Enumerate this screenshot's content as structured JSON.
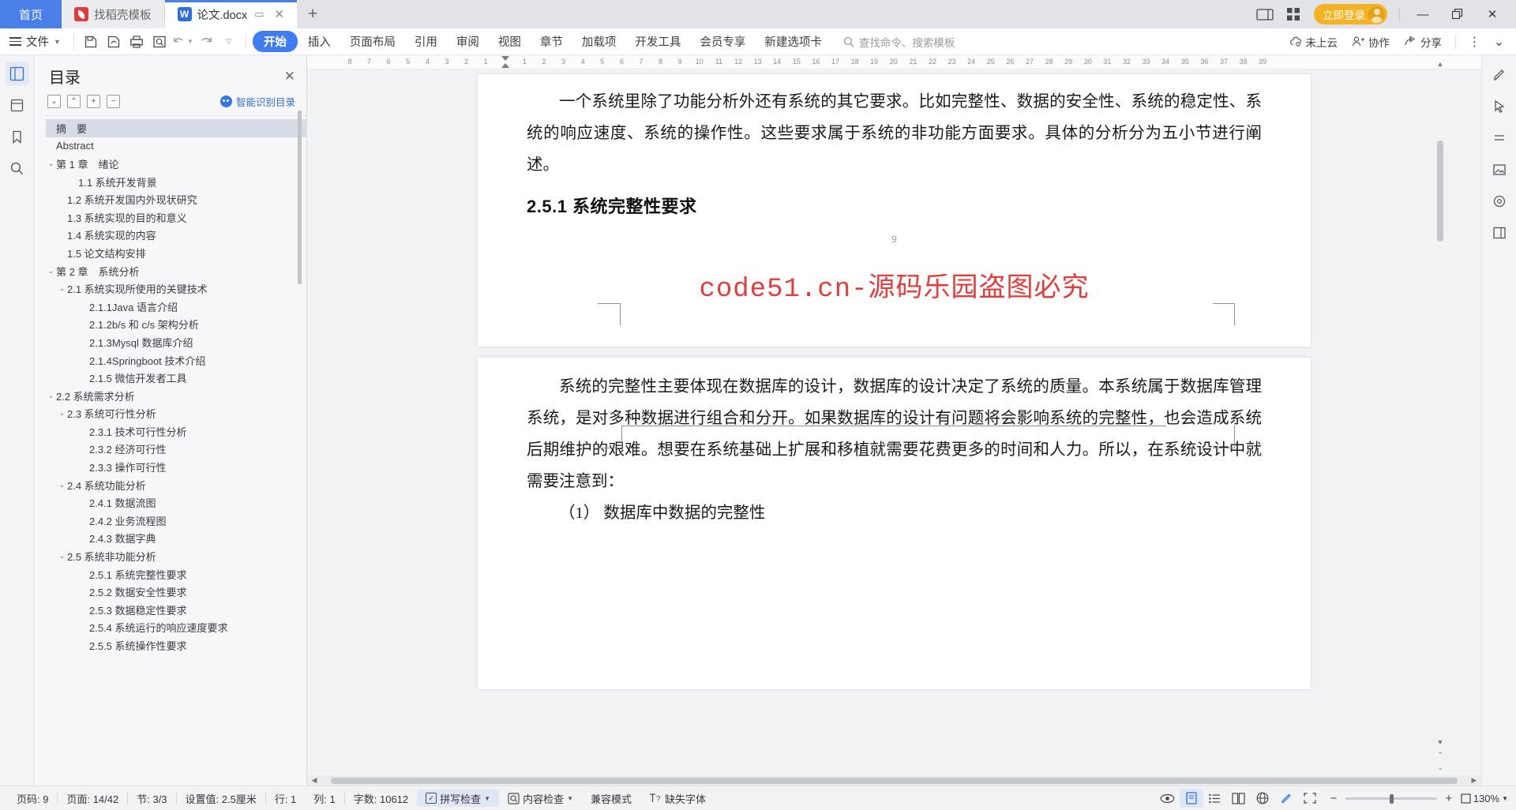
{
  "window": {
    "tabs": [
      {
        "label": "首页",
        "type": "home"
      },
      {
        "label": "找稻壳模板",
        "type": "inactive",
        "icon": "docer-icon"
      },
      {
        "label": "论文.docx",
        "type": "active",
        "icon": "word-doc-icon"
      }
    ],
    "new_tab": "+",
    "login_label": "立即登录",
    "minimize": "—",
    "restore": "❐",
    "close": "✕"
  },
  "ribbon": {
    "file_label": "文件",
    "quick_icons": [
      "save-icon",
      "save-as-icon",
      "print-icon",
      "print-preview-icon",
      "undo-icon",
      "redo-icon",
      "customize-icon"
    ],
    "tabs": [
      {
        "label": "开始",
        "active": true
      },
      {
        "label": "插入",
        "active": false
      },
      {
        "label": "页面布局",
        "active": false
      },
      {
        "label": "引用",
        "active": false
      },
      {
        "label": "审阅",
        "active": false
      },
      {
        "label": "视图",
        "active": false
      },
      {
        "label": "章节",
        "active": false
      },
      {
        "label": "加载项",
        "active": false
      },
      {
        "label": "开发工具",
        "active": false
      },
      {
        "label": "会员专享",
        "active": false
      },
      {
        "label": "新建选项卡",
        "active": false
      }
    ],
    "search_placeholder": "查找命令、搜索模板",
    "right_items": [
      {
        "label": "未上云",
        "icon": "cloud-off-icon"
      },
      {
        "label": "协作",
        "icon": "collaborate-icon"
      },
      {
        "label": "分享",
        "icon": "share-icon"
      }
    ],
    "more": "⋮",
    "collapse": "⌄"
  },
  "left_rail": [
    {
      "icon": "toc-panel-icon",
      "active": true
    },
    {
      "icon": "clip-panel-icon",
      "active": false
    },
    {
      "icon": "bookmark-icon",
      "active": false
    },
    {
      "icon": "search-icon",
      "active": false
    }
  ],
  "right_rail": [
    {
      "icon": "pen-edit-icon"
    },
    {
      "icon": "cursor-select-icon"
    },
    {
      "icon": "line-style-icon"
    },
    {
      "icon": "picture-icon"
    },
    {
      "icon": "shape-icon"
    },
    {
      "icon": "layout-icon"
    }
  ],
  "toc": {
    "title": "目录",
    "close": "✕",
    "tools": [
      {
        "name": "expand-all",
        "glyph": "⌄"
      },
      {
        "name": "collapse-all",
        "glyph": "⌃"
      },
      {
        "name": "increase-level",
        "glyph": "+"
      },
      {
        "name": "decrease-level",
        "glyph": "−"
      }
    ],
    "smart_label": "智能识别目录",
    "items": [
      {
        "label": "摘　要",
        "indent": 0,
        "arrow": "",
        "selected": true
      },
      {
        "label": "Abstract",
        "indent": 0,
        "arrow": "",
        "selected": false
      },
      {
        "label": "第 1 章　绪论",
        "indent": 0,
        "arrow": "⌄",
        "selected": false
      },
      {
        "label": "1.1 系统开发背景",
        "indent": 2,
        "arrow": "",
        "selected": false
      },
      {
        "label": "1.2 系统开发国内外现状研究",
        "indent": 1,
        "arrow": "",
        "selected": false
      },
      {
        "label": "1.3 系统实现的目的和意义",
        "indent": 1,
        "arrow": "",
        "selected": false
      },
      {
        "label": "1.4 系统实现的内容",
        "indent": 1,
        "arrow": "",
        "selected": false
      },
      {
        "label": "1.5 论文结构安排",
        "indent": 1,
        "arrow": "",
        "selected": false
      },
      {
        "label": "第 2 章　系统分析",
        "indent": 0,
        "arrow": "⌄",
        "selected": false
      },
      {
        "label": "2.1 系统实现所使用的关键技术",
        "indent": 1,
        "arrow": "⌄",
        "selected": false
      },
      {
        "label": "2.1.1Java 语言介绍",
        "indent": 3,
        "arrow": "",
        "selected": false
      },
      {
        "label": "2.1.2b/s 和 c/s 架构分析",
        "indent": 3,
        "arrow": "",
        "selected": false
      },
      {
        "label": "2.1.3Mysql 数据库介绍",
        "indent": 3,
        "arrow": "",
        "selected": false
      },
      {
        "label": "2.1.4Springboot 技术介绍",
        "indent": 3,
        "arrow": "",
        "selected": false
      },
      {
        "label": "2.1.5 微信开发者工具",
        "indent": 3,
        "arrow": "",
        "selected": false
      },
      {
        "label": "2.2 系统需求分析",
        "indent": 0,
        "arrow": "⌄",
        "selected": false
      },
      {
        "label": "2.3 系统可行性分析",
        "indent": 1,
        "arrow": "⌄",
        "selected": false
      },
      {
        "label": "2.3.1 技术可行性分析",
        "indent": 3,
        "arrow": "",
        "selected": false
      },
      {
        "label": "2.3.2 经济可行性",
        "indent": 3,
        "arrow": "",
        "selected": false
      },
      {
        "label": "2.3.3 操作可行性",
        "indent": 3,
        "arrow": "",
        "selected": false
      },
      {
        "label": "2.4 系统功能分析",
        "indent": 1,
        "arrow": "⌄",
        "selected": false
      },
      {
        "label": "2.4.1 数据流图",
        "indent": 3,
        "arrow": "",
        "selected": false
      },
      {
        "label": "2.4.2 业务流程图",
        "indent": 3,
        "arrow": "",
        "selected": false
      },
      {
        "label": "2.4.3 数据字典",
        "indent": 3,
        "arrow": "",
        "selected": false
      },
      {
        "label": "2.5 系统非功能分析",
        "indent": 1,
        "arrow": "⌄",
        "selected": false
      },
      {
        "label": "2.5.1 系统完整性要求",
        "indent": 3,
        "arrow": "",
        "selected": false
      },
      {
        "label": "2.5.2 数据安全性要求",
        "indent": 3,
        "arrow": "",
        "selected": false
      },
      {
        "label": "2.5.3 数据稳定性要求",
        "indent": 3,
        "arrow": "",
        "selected": false
      },
      {
        "label": "2.5.4 系统运行的响应速度要求",
        "indent": 3,
        "arrow": "",
        "selected": false
      },
      {
        "label": "2.5.5 系统操作性要求",
        "indent": 3,
        "arrow": "",
        "selected": false
      }
    ]
  },
  "ruler": {
    "numbers": [
      "8",
      "7",
      "6",
      "5",
      "4",
      "3",
      "2",
      "1",
      "",
      "1",
      "2",
      "3",
      "4",
      "5",
      "6",
      "7",
      "8",
      "9",
      "10",
      "11",
      "12",
      "13",
      "14",
      "15",
      "16",
      "17",
      "18",
      "19",
      "20",
      "21",
      "22",
      "23",
      "24",
      "25",
      "26",
      "27",
      "28",
      "29",
      "30",
      "31",
      "32",
      "33",
      "34",
      "35",
      "36",
      "37",
      "38",
      "39"
    ]
  },
  "document": {
    "page1": {
      "paragraph1": "一个系统里除了功能分析外还有系统的其它要求。比如完整性、数据的安全性、系统的稳定性、系统的响应速度、系统的操作性。这些要求属于系统的非功能方面要求。具体的分析分为五小节进行阐述。",
      "heading": "2.5.1 系统完整性要求",
      "page_marker": "9"
    },
    "watermark": "code51.cn-源码乐园盗图必究",
    "page2": {
      "paragraph1": "系统的完整性主要体现在数据库的设计，数据库的设计决定了系统的质量。本系统属于数据库管理系统，是对多种数据进行组合和分开。如果数据库的设计有问题将会影响系统的完整性，也会造成系统后期维护的艰难。想要在系统基础上扩展和移植就需要花费更多的时间和人力。所以，在系统设计中就需要注意到：",
      "paragraph2": "（1） 数据库中数据的完整性"
    }
  },
  "status": {
    "left_items": [
      {
        "label": "页码: 9",
        "name": "page-number"
      },
      {
        "label": "页面: 14/42",
        "name": "page-count"
      },
      {
        "label": "节: 3/3",
        "name": "section"
      },
      {
        "label": "设置值: 2.5厘米",
        "name": "margin-value"
      },
      {
        "label": "行: 1",
        "name": "row"
      },
      {
        "label": "列: 1",
        "name": "column"
      },
      {
        "label": "字数: 10612",
        "name": "word-count"
      }
    ],
    "spell_check": "拼写检查",
    "content_check": "内容检查",
    "compat_mode": "兼容模式",
    "missing_font": "缺失字体",
    "zoom": "130%",
    "zoom_minus": "−",
    "zoom_plus": "+",
    "view_buttons": [
      "read-mode-icon",
      "page-view-icon",
      "outline-view-icon",
      "two-page-icon",
      "web-view-icon",
      "pen-mode-icon",
      "fullscreen-icon"
    ]
  },
  "colors": {
    "accent": "#3f7df0",
    "login": "#f5b324",
    "watermark": "#e33c3c",
    "home_tab": "#4a7fe8"
  }
}
